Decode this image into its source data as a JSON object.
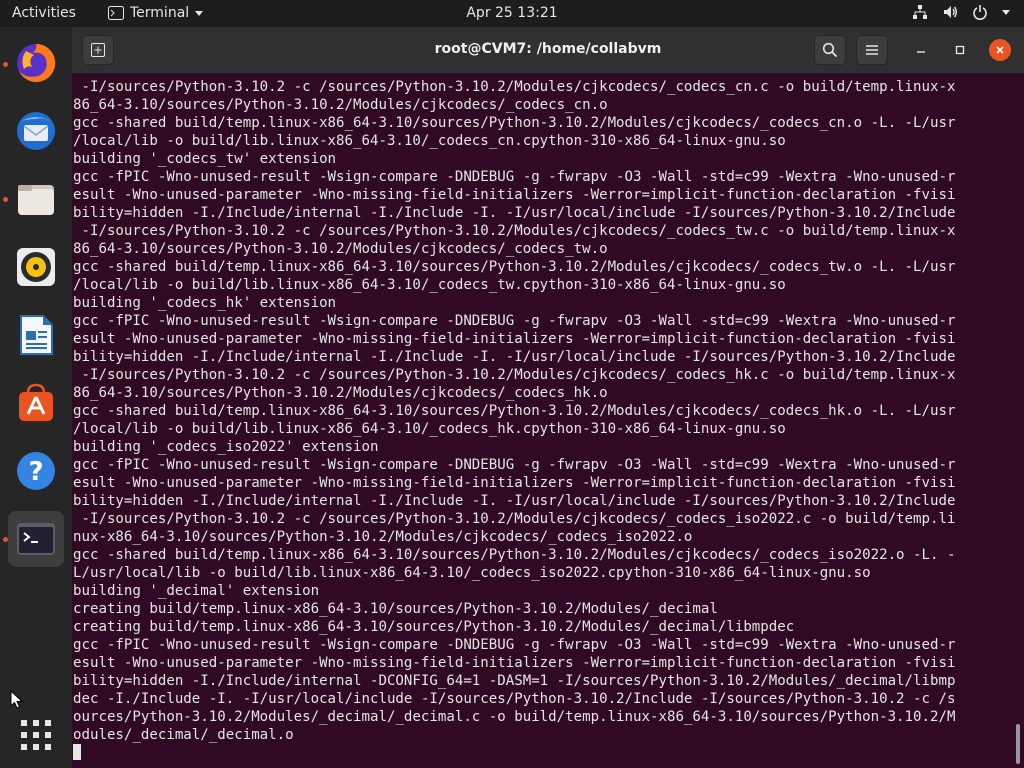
{
  "topbar": {
    "activities": "Activities",
    "app_name": "Terminal",
    "clock": "Apr 25  13:21",
    "tray_icons": [
      "network-icon",
      "volume-icon",
      "power-icon",
      "chevron-down-icon"
    ]
  },
  "dock": {
    "items": [
      "firefox-icon",
      "thunderbird-icon",
      "files-icon",
      "rhythmbox-icon",
      "libreoffice-writer-icon",
      "app-store-icon",
      "help-icon",
      "terminal-icon"
    ],
    "show_apps": "show-applications-icon"
  },
  "window": {
    "title": "root@CVM7: /home/collabvm",
    "buttons": [
      "new-tab-icon",
      "search-icon",
      "menu-icon",
      "minimize-icon",
      "maximize-icon",
      "close-icon"
    ]
  },
  "colors": {
    "terminal_bg": "#300a24",
    "close_button": "#e95420",
    "accent": "#e95420"
  },
  "terminal": {
    "lines": [
      " -I/sources/Python-3.10.2 -c /sources/Python-3.10.2/Modules/cjkcodecs/_codecs_cn.c -o build/temp.linux-x",
      "86_64-3.10/sources/Python-3.10.2/Modules/cjkcodecs/_codecs_cn.o",
      "gcc -shared build/temp.linux-x86_64-3.10/sources/Python-3.10.2/Modules/cjkcodecs/_codecs_cn.o -L. -L/usr",
      "/local/lib -o build/lib.linux-x86_64-3.10/_codecs_cn.cpython-310-x86_64-linux-gnu.so",
      "building '_codecs_tw' extension",
      "gcc -fPIC -Wno-unused-result -Wsign-compare -DNDEBUG -g -fwrapv -O3 -Wall -std=c99 -Wextra -Wno-unused-r",
      "esult -Wno-unused-parameter -Wno-missing-field-initializers -Werror=implicit-function-declaration -fvisi",
      "bility=hidden -I./Include/internal -I./Include -I. -I/usr/local/include -I/sources/Python-3.10.2/Include",
      " -I/sources/Python-3.10.2 -c /sources/Python-3.10.2/Modules/cjkcodecs/_codecs_tw.c -o build/temp.linux-x",
      "86_64-3.10/sources/Python-3.10.2/Modules/cjkcodecs/_codecs_tw.o",
      "gcc -shared build/temp.linux-x86_64-3.10/sources/Python-3.10.2/Modules/cjkcodecs/_codecs_tw.o -L. -L/usr",
      "/local/lib -o build/lib.linux-x86_64-3.10/_codecs_tw.cpython-310-x86_64-linux-gnu.so",
      "building '_codecs_hk' extension",
      "gcc -fPIC -Wno-unused-result -Wsign-compare -DNDEBUG -g -fwrapv -O3 -Wall -std=c99 -Wextra -Wno-unused-r",
      "esult -Wno-unused-parameter -Wno-missing-field-initializers -Werror=implicit-function-declaration -fvisi",
      "bility=hidden -I./Include/internal -I./Include -I. -I/usr/local/include -I/sources/Python-3.10.2/Include",
      " -I/sources/Python-3.10.2 -c /sources/Python-3.10.2/Modules/cjkcodecs/_codecs_hk.c -o build/temp.linux-x",
      "86_64-3.10/sources/Python-3.10.2/Modules/cjkcodecs/_codecs_hk.o",
      "gcc -shared build/temp.linux-x86_64-3.10/sources/Python-3.10.2/Modules/cjkcodecs/_codecs_hk.o -L. -L/usr",
      "/local/lib -o build/lib.linux-x86_64-3.10/_codecs_hk.cpython-310-x86_64-linux-gnu.so",
      "building '_codecs_iso2022' extension",
      "gcc -fPIC -Wno-unused-result -Wsign-compare -DNDEBUG -g -fwrapv -O3 -Wall -std=c99 -Wextra -Wno-unused-r",
      "esult -Wno-unused-parameter -Wno-missing-field-initializers -Werror=implicit-function-declaration -fvisi",
      "bility=hidden -I./Include/internal -I./Include -I. -I/usr/local/include -I/sources/Python-3.10.2/Include",
      " -I/sources/Python-3.10.2 -c /sources/Python-3.10.2/Modules/cjkcodecs/_codecs_iso2022.c -o build/temp.li",
      "nux-x86_64-3.10/sources/Python-3.10.2/Modules/cjkcodecs/_codecs_iso2022.o",
      "gcc -shared build/temp.linux-x86_64-3.10/sources/Python-3.10.2/Modules/cjkcodecs/_codecs_iso2022.o -L. -",
      "L/usr/local/lib -o build/lib.linux-x86_64-3.10/_codecs_iso2022.cpython-310-x86_64-linux-gnu.so",
      "building '_decimal' extension",
      "creating build/temp.linux-x86_64-3.10/sources/Python-3.10.2/Modules/_decimal",
      "creating build/temp.linux-x86_64-3.10/sources/Python-3.10.2/Modules/_decimal/libmpdec",
      "gcc -fPIC -Wno-unused-result -Wsign-compare -DNDEBUG -g -fwrapv -O3 -Wall -std=c99 -Wextra -Wno-unused-r",
      "esult -Wno-unused-parameter -Wno-missing-field-initializers -Werror=implicit-function-declaration -fvisi",
      "bility=hidden -I./Include/internal -DCONFIG_64=1 -DASM=1 -I/sources/Python-3.10.2/Modules/_decimal/libmp",
      "dec -I./Include -I. -I/usr/local/include -I/sources/Python-3.10.2/Include -I/sources/Python-3.10.2 -c /s",
      "ources/Python-3.10.2/Modules/_decimal/_decimal.c -o build/temp.linux-x86_64-3.10/sources/Python-3.10.2/M",
      "odules/_decimal/_decimal.o"
    ]
  }
}
